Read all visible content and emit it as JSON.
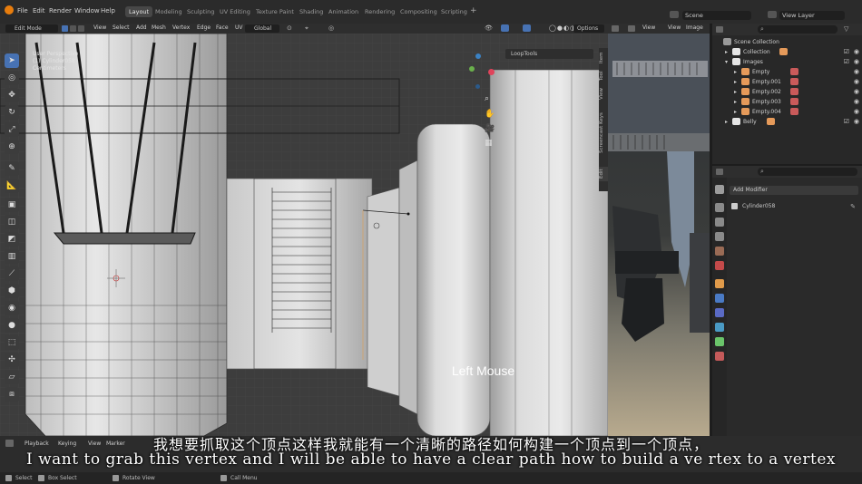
{
  "menu": {
    "file": "File",
    "edit": "Edit",
    "render": "Render",
    "window": "Window",
    "help": "Help"
  },
  "workspaces": [
    "Layout",
    "Modeling",
    "Sculpting",
    "UV Editing",
    "Texture Paint",
    "Shading",
    "Animation",
    "Rendering",
    "Compositing",
    "Scripting"
  ],
  "scene": {
    "label": "Scene",
    "view_layer": "View Layer"
  },
  "viewport_header": {
    "mode": "Edit Mode",
    "menus": [
      "View",
      "Select",
      "Add",
      "Mesh",
      "Vertex",
      "Edge",
      "Face",
      "UV"
    ],
    "orientation": "Global",
    "options": "Options"
  },
  "viewport": {
    "overlay_text": [
      "User Perspective",
      "(1) Cylinder058",
      "Centimeters"
    ],
    "loop_tools": "LoopTools",
    "npanel_tabs": [
      "Item",
      "Tool",
      "View",
      "Screencast Keys",
      "Edit"
    ],
    "key_hint": "Left Mouse"
  },
  "image_editor": {
    "view": "View",
    "view2": "View",
    "image": "Image"
  },
  "outliner": {
    "rows": [
      {
        "label": "Scene Collection",
        "indent": 0,
        "color": "#9a9a9a"
      },
      {
        "label": "Collection",
        "indent": 1,
        "color": "#e5e5e5"
      },
      {
        "label": "Images",
        "indent": 1,
        "color": "#e5e5e5"
      },
      {
        "label": "Empty",
        "indent": 2,
        "color": "#e59a5a"
      },
      {
        "label": "Empty.001",
        "indent": 2,
        "color": "#e59a5a"
      },
      {
        "label": "Empty.002",
        "indent": 2,
        "color": "#e59a5a"
      },
      {
        "label": "Empty.003",
        "indent": 2,
        "color": "#e59a5a"
      },
      {
        "label": "Empty.004",
        "indent": 2,
        "color": "#e59a5a"
      },
      {
        "label": "Belly",
        "indent": 1,
        "color": "#e5e5e5"
      }
    ]
  },
  "properties": {
    "add_modifier": "Add Modifier",
    "object_name": "Cylinder058"
  },
  "timeline": {
    "menus": [
      "Playback",
      "Keying",
      "View",
      "Marker"
    ]
  },
  "status": {
    "select": "Select",
    "box_select": "Box Select",
    "rotate_view": "Rotate View",
    "call_menu": "Call Menu"
  },
  "subtitles": {
    "cn": "我想要抓取这个顶点这样我就能有一个清晰的路径如何构建一个顶点到一个顶点，",
    "en": "I want to grab this vertex and I will be able to have a clear path how to build a ve rtex to a vertex"
  },
  "colors": {
    "accent": "#4772b3",
    "header": "#2b2b2b",
    "viewport_bg": "#3d3d3d"
  }
}
